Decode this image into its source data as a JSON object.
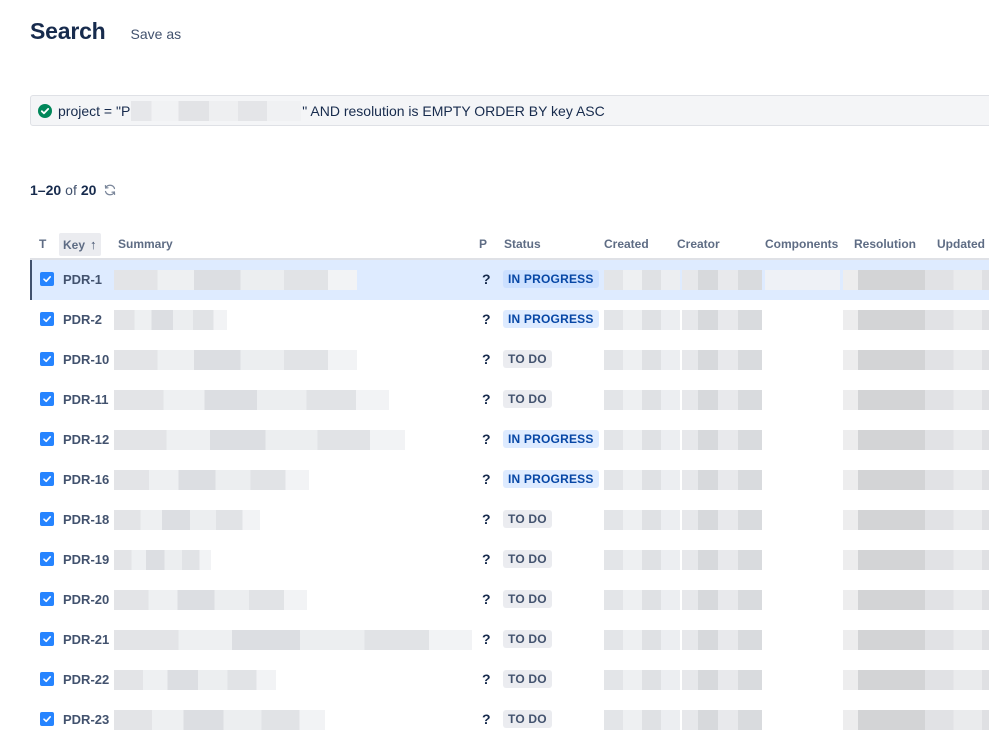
{
  "page": {
    "title": "Search",
    "save_as": "Save as"
  },
  "jql": {
    "prefix": "project = \"P",
    "suffix": "\" AND resolution is EMPTY ORDER BY key ASC",
    "valid_color": "#00875a"
  },
  "results": {
    "range": "1–20",
    "of": "of",
    "total": "20"
  },
  "columns": {
    "type": "T",
    "key": "Key",
    "summary": "Summary",
    "priority": "P",
    "status": "Status",
    "created": "Created",
    "creator": "Creator",
    "components": "Components",
    "resolution": "Resolution",
    "updated": "Updated"
  },
  "icons": {
    "valid": "check-circle-icon",
    "refresh": "refresh-icon",
    "sort": "arrow-up-icon",
    "checkbox": "checkbox-checked-icon"
  },
  "rows": [
    {
      "key": "PDR-1",
      "priority": "?",
      "status": "IN PROGRESS"
    },
    {
      "key": "PDR-2",
      "priority": "?",
      "status": "IN PROGRESS"
    },
    {
      "key": "PDR-10",
      "priority": "?",
      "status": "TO DO"
    },
    {
      "key": "PDR-11",
      "priority": "?",
      "status": "TO DO"
    },
    {
      "key": "PDR-12",
      "priority": "?",
      "status": "IN PROGRESS"
    },
    {
      "key": "PDR-16",
      "priority": "?",
      "status": "IN PROGRESS"
    },
    {
      "key": "PDR-18",
      "priority": "?",
      "status": "TO DO"
    },
    {
      "key": "PDR-19",
      "priority": "?",
      "status": "TO DO"
    },
    {
      "key": "PDR-20",
      "priority": "?",
      "status": "TO DO"
    },
    {
      "key": "PDR-21",
      "priority": "?",
      "status": "TO DO"
    },
    {
      "key": "PDR-22",
      "priority": "?",
      "status": "TO DO"
    },
    {
      "key": "PDR-23",
      "priority": "?",
      "status": "TO DO"
    }
  ]
}
